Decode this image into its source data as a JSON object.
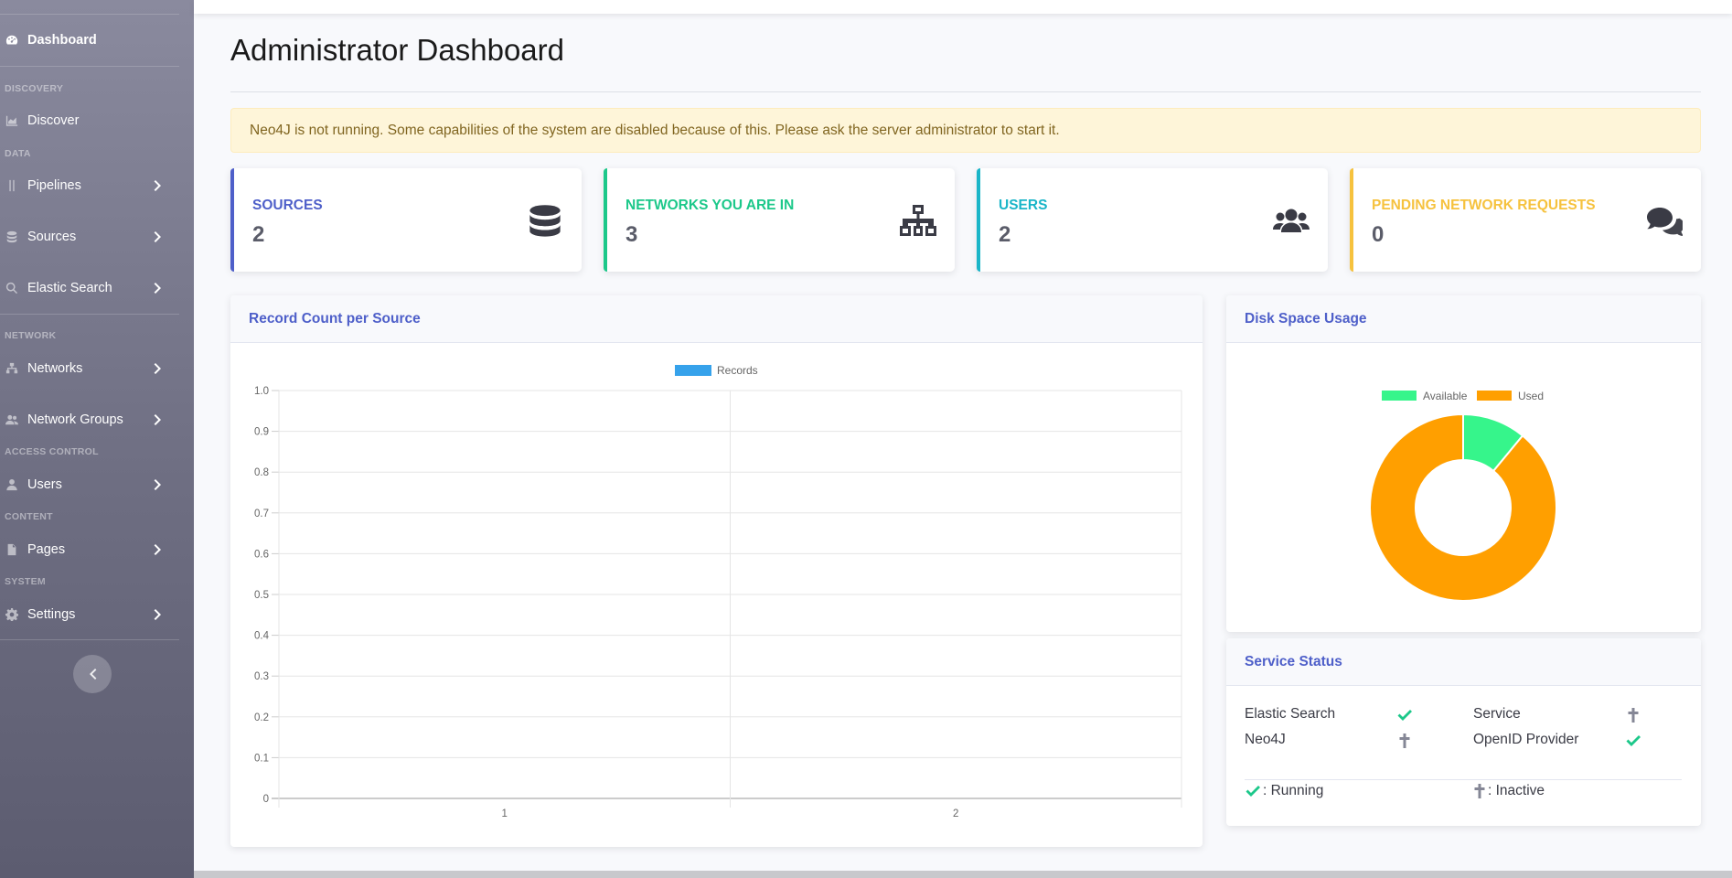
{
  "sidebar": {
    "items": [
      {
        "label": "Dashboard",
        "icon": "dashboard-icon"
      },
      {
        "heading": "DISCOVERY"
      },
      {
        "label": "Discover",
        "icon": "chart-area-icon"
      },
      {
        "heading": "DATA"
      },
      {
        "label": "Pipelines",
        "icon": "pipeline-icon"
      },
      {
        "label": "Sources",
        "icon": "database-icon"
      },
      {
        "label": "Elastic Search",
        "icon": "search-icon"
      },
      {
        "heading": "NETWORK"
      },
      {
        "label": "Networks",
        "icon": "network-icon"
      },
      {
        "label": "Network Groups",
        "icon": "users-icon"
      },
      {
        "heading": "ACCESS CONTROL"
      },
      {
        "label": "Users",
        "icon": "user-icon"
      },
      {
        "heading": "CONTENT"
      },
      {
        "label": "Pages",
        "icon": "file-icon"
      },
      {
        "heading": "SYSTEM"
      },
      {
        "label": "Settings",
        "icon": "gear-icon"
      }
    ]
  },
  "page": {
    "title": "Administrator Dashboard",
    "alert": "Neo4J is not running. Some capabilities of the system are disabled because of this. Please ask the server administrator to start it."
  },
  "stats": [
    {
      "label": "SOURCES",
      "value": "2",
      "color": "#4e5fc9",
      "icon": "database-icon"
    },
    {
      "label": "NETWORKS YOU ARE IN",
      "value": "3",
      "color": "#1cc88a",
      "icon": "sitemap-icon"
    },
    {
      "label": "USERS",
      "value": "2",
      "color": "#1ab5c8",
      "icon": "users-icon"
    },
    {
      "label": "PENDING NETWORK REQUESTS",
      "value": "0",
      "color": "#f6c23e",
      "icon": "comments-icon"
    }
  ],
  "record_card": {
    "title": "Record Count per Source"
  },
  "disk_card": {
    "title": "Disk Space Usage"
  },
  "service_card": {
    "title": "Service Status",
    "services": [
      {
        "name": "Elastic Search",
        "status": "running"
      },
      {
        "name": "Service",
        "status": "inactive"
      },
      {
        "name": "Neo4J",
        "status": "inactive"
      },
      {
        "name": "OpenID Provider",
        "status": "running"
      }
    ],
    "legend_running": ": Running",
    "legend_inactive": ": Inactive"
  },
  "colors": {
    "running": "#1cc88a",
    "inactive": "#858796",
    "records": "#36a2eb",
    "available": "#36f58b",
    "used": "#ff9f00"
  },
  "chart_data": [
    {
      "type": "bar",
      "title": "Record Count per Source",
      "categories": [
        "1",
        "2"
      ],
      "series": [
        {
          "name": "Records",
          "values": [
            0,
            0
          ]
        }
      ],
      "ylim": [
        0,
        1.0
      ],
      "yticks": [
        "0",
        "0.1",
        "0.2",
        "0.3",
        "0.4",
        "0.5",
        "0.6",
        "0.7",
        "0.8",
        "0.9",
        "1.0"
      ],
      "grid": true,
      "legend": "top"
    },
    {
      "type": "pie",
      "title": "Disk Space Usage",
      "labels": [
        "Available",
        "Used"
      ],
      "values": [
        11,
        89
      ],
      "legend": "top"
    }
  ]
}
